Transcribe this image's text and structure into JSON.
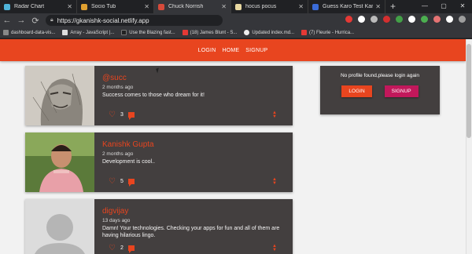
{
  "browser": {
    "tabs": [
      {
        "label": "Radar Chart",
        "color": "#4fb3d9",
        "active": false
      },
      {
        "label": "Socio Tub",
        "color": "#e0a030",
        "active": false
      },
      {
        "label": "Chuck Norrish",
        "color": "#d64a3a",
        "active": true
      },
      {
        "label": "hocus pocus",
        "color": "#e8d8a0",
        "active": false
      },
      {
        "label": "Guess Karo Test Karo",
        "color": "#3b6cd8",
        "active": false
      }
    ],
    "new_tab": "+",
    "window_controls": [
      "—",
      "▢",
      "✕"
    ],
    "url": "https://gkanishk-social.netlify.app",
    "bookmarks": [
      {
        "label": "dashboard-data-vis...",
        "color": "#888"
      },
      {
        "label": "Array - JavaScript |...",
        "color": "#ddd"
      },
      {
        "label": "Use the Blazing fast...",
        "color": "#222"
      },
      {
        "label": "(18) James Blunt - S...",
        "color": "#e53935"
      },
      {
        "label": "Updated index.md...",
        "color": "#eee"
      },
      {
        "label": "(7) Fleurie - Hurrica...",
        "color": "#e53935"
      }
    ],
    "extensions": [
      "#e53935",
      "#ffffff",
      "#bbbbbb",
      "#d32f2f",
      "#43a047",
      "#ffffff",
      "#4caf50",
      "#e57373",
      "#ffffff",
      "#9e9e9e"
    ]
  },
  "nav": {
    "login": "LOGIN",
    "home": "HOME",
    "signup": "SIGNUP",
    "bar_color": "#e8451f"
  },
  "posts": [
    {
      "name": "@succ",
      "time": "2 months ago",
      "text": "Success comes to those who dream for it!",
      "likes": "3",
      "avatar": "sketch-portrait"
    },
    {
      "name": "Kanishk Gupta",
      "time": "2 months ago",
      "text": "Development is cool..",
      "likes": "5",
      "avatar": "photo-portrait"
    },
    {
      "name": "digvijay",
      "time": "13 days ago",
      "text": "Damn! Your technologies. Checking your apps for fun and all of them are having hilarious lingo.",
      "likes": "2",
      "avatar": "default-avatar"
    }
  ],
  "profile": {
    "message": "No profile found,please login again",
    "login_button": "LOGIN",
    "signup_button": "SIGNUP"
  }
}
